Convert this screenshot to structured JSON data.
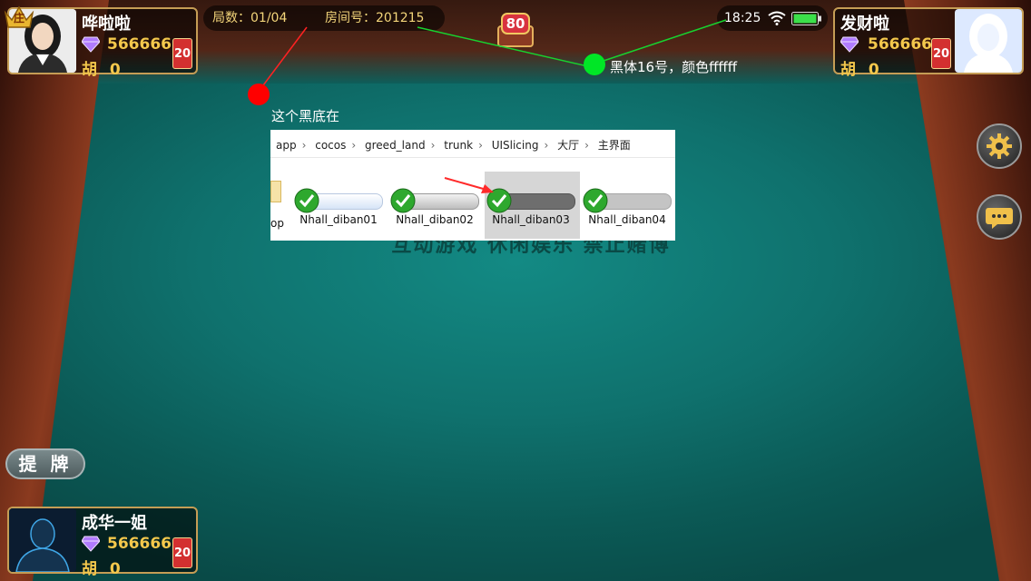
{
  "game": {
    "round_label": "局数：01/04",
    "room_label": "房间号：201215",
    "time": "18:25",
    "score_badge": "80",
    "slogan": "互动游戏 休闲娱乐 禁止赌博",
    "tipai_label": "提 牌"
  },
  "players": {
    "top_left": {
      "name": "哗啦啦",
      "coins": "566666",
      "hu_label": "胡",
      "hu": "0",
      "card": "20",
      "dealer_label": "庄"
    },
    "top_right": {
      "name": "发财啦",
      "coins": "566666",
      "hu_label": "胡",
      "hu": "0",
      "card": "20"
    },
    "bottom_left": {
      "name": "成华一姐",
      "coins": "566666",
      "hu_label": "胡",
      "hu": "0",
      "card": "20"
    }
  },
  "annotations": {
    "note_black": "这个黑底在",
    "note_font": "黑体16号，颜色ffffff",
    "colors": {
      "red_dot": "#ff0000",
      "green_dot": "#00e626",
      "green_line": "#18d12f"
    }
  },
  "explorer": {
    "breadcrumb": [
      "app",
      "cocos",
      "greed_land",
      "trunk",
      "UISlicing",
      "大厅",
      "主界面"
    ],
    "partial_left_label": "op",
    "files": [
      "Nhall_diban01",
      "Nhall_diban02",
      "Nhall_diban03",
      "Nhall_diban04"
    ]
  }
}
